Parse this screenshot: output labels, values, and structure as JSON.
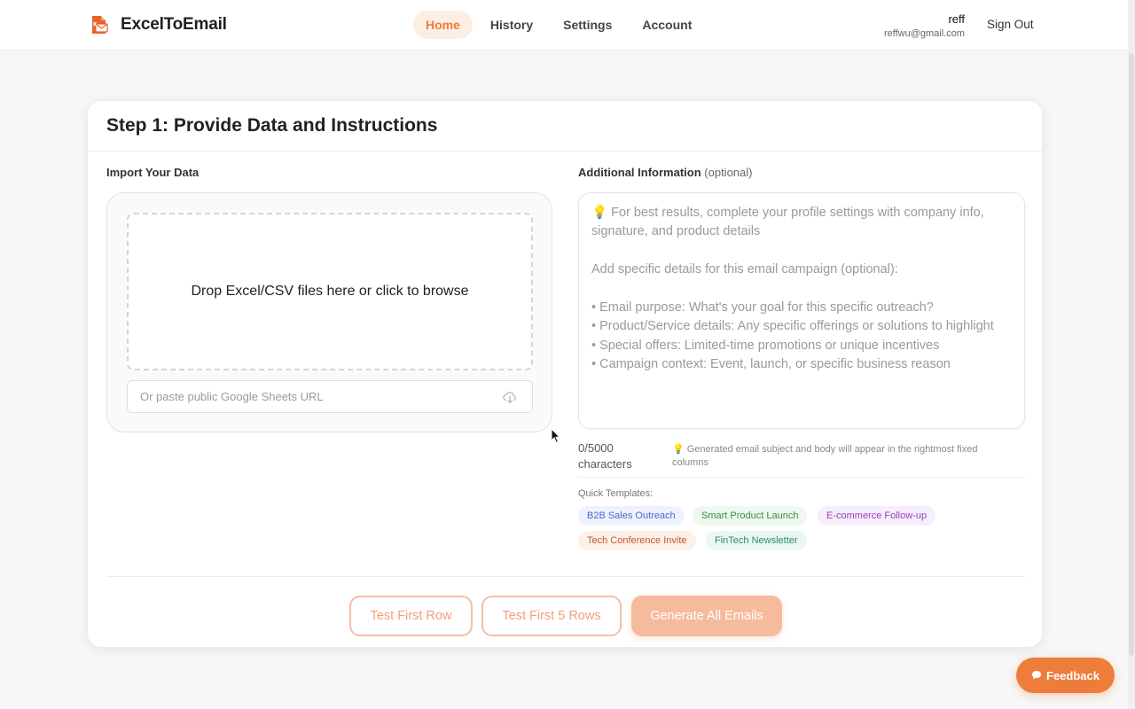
{
  "app": {
    "name": "ExcelToEmail"
  },
  "nav": {
    "items": [
      {
        "label": "Home",
        "active": true
      },
      {
        "label": "History",
        "active": false
      },
      {
        "label": "Settings",
        "active": false
      },
      {
        "label": "Account",
        "active": false
      }
    ]
  },
  "user": {
    "name": "reff",
    "email": "reffwu@gmail.com",
    "sign_out_label": "Sign Out"
  },
  "step": {
    "title": "Step 1: Provide Data and Instructions"
  },
  "import": {
    "label": "Import Your Data",
    "dropzone_text": "Drop Excel/CSV files here or click to browse",
    "url_placeholder": "Or paste public Google Sheets URL",
    "url_value": ""
  },
  "additional_info": {
    "label": "Additional Information",
    "optional_text": "(optional)",
    "placeholder_lines": [
      "💡 For best results, complete your profile settings with company info,",
      "signature, and product details",
      "",
      "Add specific details for this email campaign (optional):",
      "",
      "• Email purpose: What's your goal for this specific outreach?",
      "• Product/Service details: Any specific offerings or solutions to highlight",
      "• Special offers: Limited-time promotions or unique incentives",
      "• Campaign context: Event, launch, or specific business reason"
    ],
    "char_count": "0/5000",
    "char_count_unit": "characters",
    "hint": "💡 Generated email subject and body will appear in the rightmost fixed columns"
  },
  "templates": {
    "label": "Quick Templates:",
    "items": [
      {
        "label": "B2B Sales Outreach",
        "color": "#4a67c9"
      },
      {
        "label": "Smart Product Launch",
        "color": "#3f8a45"
      },
      {
        "label": "E-commerce Follow-up",
        "color": "#9b3fbf"
      },
      {
        "label": "Tech Conference Invite",
        "color": "#c1592a"
      },
      {
        "label": "FinTech Newsletter",
        "color": "#2b8a73"
      }
    ]
  },
  "actions": {
    "test_first_row": "Test First Row",
    "test_first_5_rows": "Test First 5 Rows",
    "generate_all": "Generate All Emails"
  },
  "feedback": {
    "label": "Feedback",
    "icon": "chat-bubble-icon"
  },
  "colors": {
    "accent": "#ee7d3b",
    "accent_light": "#f5bb9c",
    "nav_active_bg": "#fdeee3"
  }
}
